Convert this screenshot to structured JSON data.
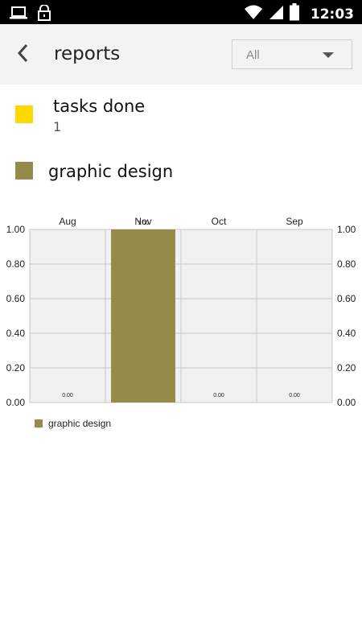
{
  "status_bar": {
    "time": "12:03",
    "left_icons": [
      "laptop-icon",
      "lock-icon"
    ],
    "right_icons": [
      "wifi-icon",
      "signal-icon",
      "battery-icon"
    ]
  },
  "header": {
    "title": "reports",
    "filter": {
      "selected": "All"
    }
  },
  "summary": {
    "label": "tasks done",
    "value": "1",
    "color": "#ffd800"
  },
  "category": {
    "label": "graphic design",
    "color": "#958b48"
  },
  "chart_data": {
    "type": "bar",
    "categories": [
      "Aug",
      "Nov",
      "Oct",
      "Sep"
    ],
    "series": [
      {
        "name": "graphic design",
        "values": [
          0.0,
          1.0,
          0.0,
          0.0
        ],
        "color": "#958b48"
      }
    ],
    "value_labels": [
      "0.00",
      "1.00",
      "0.00",
      "0.00"
    ],
    "y_ticks": [
      "0.00",
      "0.20",
      "0.40",
      "0.60",
      "0.80",
      "1.00"
    ],
    "ylim": [
      0,
      1
    ],
    "y_axis": "both-sides",
    "grid": true,
    "legend": "bottom-left",
    "plot_background": "#f0f0f0",
    "grid_color": "#c8c8c8"
  }
}
